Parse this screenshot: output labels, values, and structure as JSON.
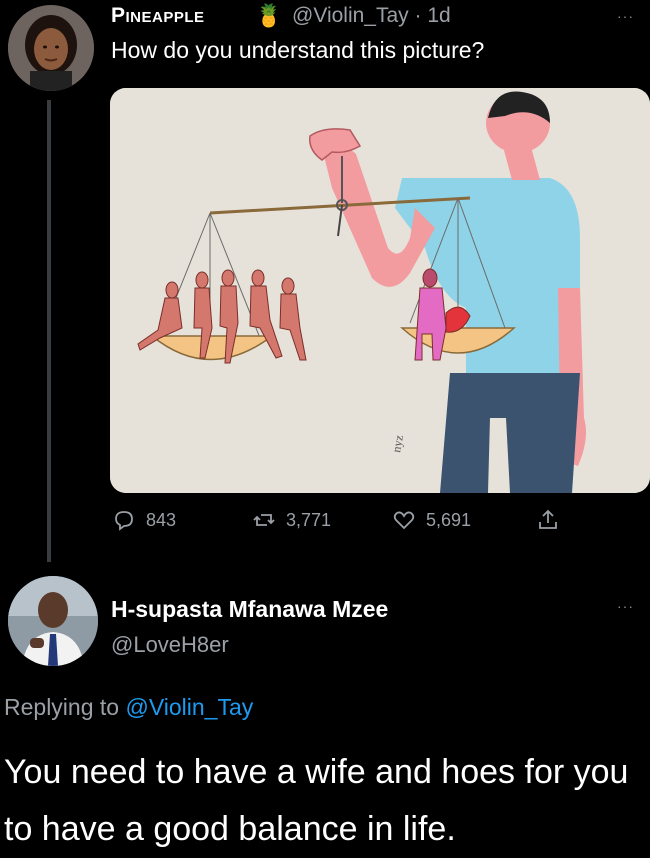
{
  "tweet": {
    "author_name": "Pineapple",
    "author_emoji": "🍍",
    "handle_time": "@Violin_Tay · 1d",
    "text": "How do you understand this picture?",
    "more_label": "···",
    "stats": {
      "replies": "843",
      "retweets": "3,771",
      "likes": "5,691"
    },
    "image_signature": "nyz"
  },
  "reply": {
    "author_name": "H-supasta Mfanawa Mzee",
    "handle": "@LoveH8er",
    "more_label": "···",
    "replying_prefix": "Replying to ",
    "replying_to": "@Violin_Tay",
    "text": "You need to have a wife and hoes for you to have a good balance in life."
  },
  "colors": {
    "background": "#000000",
    "muted_text": "#9aa0a6",
    "link": "#1d9bf0",
    "thread_line": "#3a3d40"
  }
}
